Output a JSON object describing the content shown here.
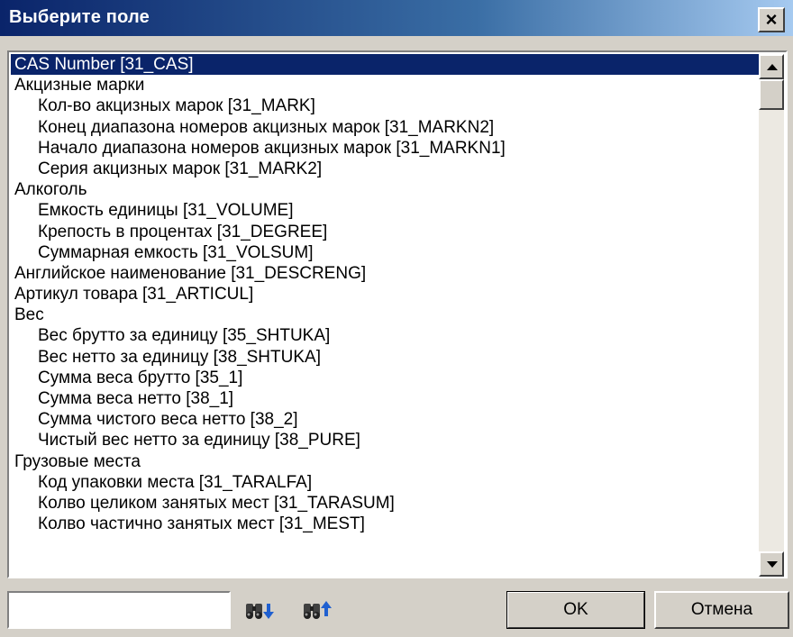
{
  "window": {
    "title": "Выберите поле",
    "close_label": "×"
  },
  "list": {
    "selected_index": 0,
    "items": [
      {
        "label": "CAS Number  [31_CAS]",
        "level": 0
      },
      {
        "label": "Акцизные марки",
        "level": 0
      },
      {
        "label": "Кол-во акцизных марок  [31_MARK]",
        "level": 1
      },
      {
        "label": "Конец диапазона номеров акцизных марок  [31_MARKN2]",
        "level": 1
      },
      {
        "label": "Начало диапазона номеров акцизных марок  [31_MARKN1]",
        "level": 1
      },
      {
        "label": "Серия акцизных марок  [31_MARK2]",
        "level": 1
      },
      {
        "label": "Алкоголь",
        "level": 0
      },
      {
        "label": "Емкость единицы  [31_VOLUME]",
        "level": 1
      },
      {
        "label": "Крепость в процентах  [31_DEGREE]",
        "level": 1
      },
      {
        "label": "Суммарная емкость  [31_VOLSUM]",
        "level": 1
      },
      {
        "label": "Английское наименование  [31_DESCRENG]",
        "level": 0
      },
      {
        "label": "Артикул товара  [31_ARTICUL]",
        "level": 0
      },
      {
        "label": "Вес",
        "level": 0
      },
      {
        "label": "Вес брутто за единицу  [35_SHTUKA]",
        "level": 1
      },
      {
        "label": "Вес нетто за единицу  [38_SHTUKA]",
        "level": 1
      },
      {
        "label": "Сумма веса брутто  [35_1]",
        "level": 1
      },
      {
        "label": "Сумма веса нетто  [38_1]",
        "level": 1
      },
      {
        "label": "Сумма чистого веса нетто  [38_2]",
        "level": 1
      },
      {
        "label": "Чистый вес нетто за единицу  [38_PURE]",
        "level": 1
      },
      {
        "label": "Грузовые места",
        "level": 0
      },
      {
        "label": "Код упаковки места  [31_TARALFA]",
        "level": 1
      },
      {
        "label": "Колво целиком занятых мест  [31_TARASUM]",
        "level": 1
      },
      {
        "label": "Колво частично занятых мест  [31_MEST]",
        "level": 1
      }
    ]
  },
  "search": {
    "value": "",
    "placeholder": ""
  },
  "icons": {
    "find_next": "binoculars-down-icon",
    "find_prev": "binoculars-up-icon"
  },
  "buttons": {
    "ok_label": "OK",
    "cancel_label": "Отмена"
  },
  "colors": {
    "selection": "#0a246a",
    "titlebar_start": "#0a246a",
    "titlebar_end": "#a6caf0",
    "face": "#d4d0c8"
  }
}
